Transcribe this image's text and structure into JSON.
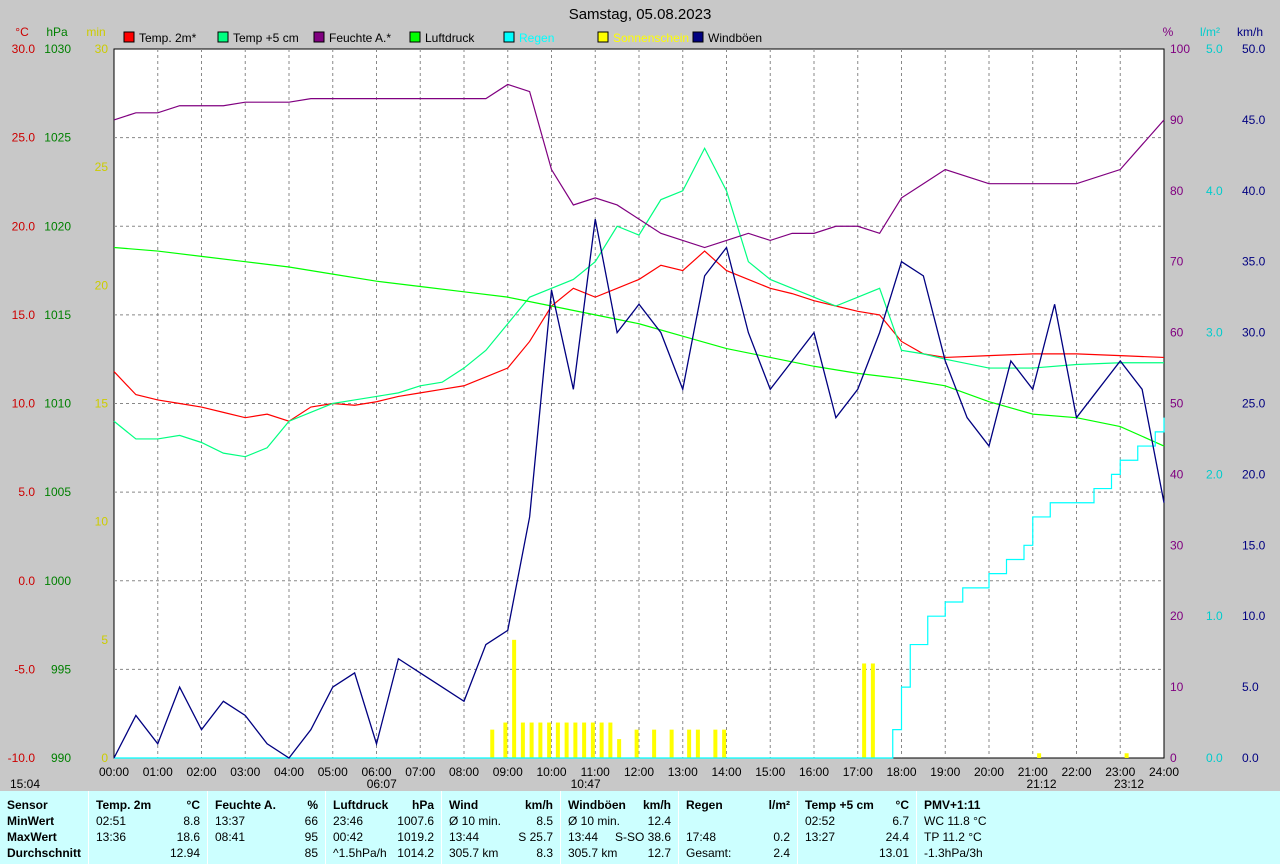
{
  "chart_data": {
    "type": "line",
    "title": "Samstag, 05.08.2023",
    "x_ticks": [
      "00:00",
      "01:00",
      "02:00",
      "03:00",
      "04:00",
      "05:00",
      "06:00",
      "07:00",
      "08:00",
      "09:00",
      "10:00",
      "11:00",
      "12:00",
      "13:00",
      "14:00",
      "15:00",
      "16:00",
      "17:00",
      "18:00",
      "19:00",
      "20:00",
      "21:00",
      "22:00",
      "23:00",
      "24:00"
    ],
    "axes": {
      "temp": {
        "unit": "°C",
        "range": [
          -10,
          30
        ],
        "ticks": [
          "30.0",
          "25.0",
          "20.0",
          "15.0",
          "10.0",
          "5.0",
          "0.0",
          "-5.0",
          "-10.0"
        ],
        "color": "#ff0000"
      },
      "pressure": {
        "unit": "hPa",
        "range": [
          990,
          1030
        ],
        "ticks": [
          "1030",
          "1025",
          "1020",
          "1015",
          "1010",
          "1005",
          "1000",
          "995",
          "990"
        ],
        "color": "#008000"
      },
      "sun": {
        "unit": "min",
        "range": [
          0,
          30
        ],
        "ticks": [
          "30",
          "25",
          "20",
          "15",
          "10",
          "5",
          "0"
        ],
        "color": "#ffff00"
      },
      "humidity": {
        "unit": "%",
        "range": [
          0,
          100
        ],
        "ticks": [
          "100",
          "90",
          "80",
          "70",
          "60",
          "50",
          "40",
          "30",
          "20",
          "10",
          "0"
        ],
        "color": "#800080"
      },
      "rain": {
        "unit": "l/m²",
        "range": [
          0,
          5
        ],
        "ticks": [
          "5.0",
          "4.0",
          "3.0",
          "2.0",
          "1.0",
          "0.0"
        ],
        "color": "#00ffff"
      },
      "wind": {
        "unit": "km/h",
        "range": [
          0,
          50
        ],
        "ticks": [
          "50.0",
          "45.0",
          "40.0",
          "35.0",
          "30.0",
          "25.0",
          "20.0",
          "15.0",
          "10.0",
          "5.0",
          "0.0"
        ],
        "color": "#000080"
      }
    },
    "legend": {
      "position": "top",
      "items": [
        {
          "name": "Temp. 2m*",
          "color": "#ff0000"
        },
        {
          "name": "Temp +5 cm",
          "color": "#00ff80"
        },
        {
          "name": "Feuchte A.*",
          "color": "#800080"
        },
        {
          "name": "Luftdruck",
          "color": "#00ff00"
        },
        {
          "name": "Regen",
          "color": "#00ffff"
        },
        {
          "name": "Sonnenschein",
          "color": "#ffff00"
        },
        {
          "name": "Windböen",
          "color": "#000080"
        }
      ]
    },
    "series": [
      {
        "key": "temp2m",
        "axis": "temp",
        "color": "#ff0000",
        "x": [
          0,
          0.5,
          1,
          1.5,
          2,
          2.5,
          3,
          3.5,
          4,
          4.5,
          5,
          5.5,
          6,
          6.5,
          7,
          7.5,
          8,
          8.5,
          9,
          9.5,
          10,
          10.5,
          11,
          11.5,
          12,
          12.5,
          13,
          13.5,
          14,
          14.5,
          15,
          15.5,
          16,
          16.5,
          17,
          17.5,
          18,
          18.5,
          19,
          20,
          21,
          22,
          23,
          24
        ],
        "y": [
          11.8,
          10.5,
          10.2,
          10.0,
          9.8,
          9.5,
          9.2,
          9.4,
          9.0,
          9.8,
          10.0,
          9.9,
          10.1,
          10.4,
          10.6,
          10.8,
          11.0,
          11.5,
          12.0,
          13.5,
          15.5,
          16.5,
          16.0,
          16.5,
          17.0,
          17.8,
          17.5,
          18.6,
          17.5,
          17.0,
          16.5,
          16.2,
          15.8,
          15.5,
          15.2,
          15.0,
          13.5,
          12.8,
          12.6,
          12.7,
          12.8,
          12.8,
          12.7,
          12.6
        ]
      },
      {
        "key": "temp5cm",
        "axis": "temp",
        "color": "#00ff80",
        "x": [
          0,
          0.5,
          1,
          1.5,
          2,
          2.5,
          3,
          3.5,
          4,
          4.5,
          5,
          5.5,
          6,
          6.5,
          7,
          7.5,
          8,
          8.5,
          9,
          9.5,
          10,
          10.5,
          11,
          11.5,
          12,
          12.5,
          13,
          13.5,
          14,
          14.5,
          15,
          15.5,
          16,
          16.5,
          17,
          17.5,
          18,
          18.5,
          19,
          20,
          21,
          22,
          23,
          24
        ],
        "y": [
          9.0,
          8.0,
          8.0,
          8.2,
          7.8,
          7.2,
          7.0,
          7.5,
          9.0,
          9.5,
          10.0,
          10.2,
          10.4,
          10.6,
          11.0,
          11.2,
          12.0,
          13.0,
          14.5,
          16.0,
          16.5,
          17.0,
          18.0,
          20.0,
          19.5,
          21.5,
          22.0,
          24.4,
          22.0,
          18.0,
          17.0,
          16.5,
          16.0,
          15.5,
          16.0,
          16.5,
          13.0,
          12.8,
          12.5,
          12.0,
          12.0,
          12.2,
          12.3,
          12.3
        ]
      },
      {
        "key": "humidity",
        "axis": "humidity",
        "color": "#800080",
        "x": [
          0,
          0.5,
          1,
          1.5,
          2,
          2.5,
          3,
          3.5,
          4,
          4.5,
          5,
          5.5,
          6,
          6.5,
          7,
          7.5,
          8,
          8.5,
          9,
          9.5,
          10,
          10.5,
          11,
          11.5,
          12,
          12.5,
          13,
          13.5,
          14,
          14.5,
          15,
          15.5,
          16,
          16.5,
          17,
          17.5,
          18,
          18.5,
          19,
          20,
          21,
          22,
          23,
          24
        ],
        "y": [
          90,
          91,
          91,
          92,
          92,
          92,
          92.5,
          92.5,
          92.5,
          93,
          93,
          93,
          93,
          93,
          93,
          93,
          93,
          93,
          95,
          94,
          83,
          78,
          79,
          78,
          76,
          74,
          73,
          72,
          73,
          74,
          73,
          74,
          74,
          75,
          75,
          74,
          79,
          81,
          83,
          81,
          81,
          81,
          83,
          90
        ]
      },
      {
        "key": "pressure",
        "axis": "pressure",
        "color": "#00ff00",
        "x": [
          0,
          1,
          2,
          3,
          4,
          5,
          6,
          7,
          8,
          9,
          10,
          11,
          12,
          13,
          14,
          15,
          16,
          17,
          18,
          19,
          20,
          21,
          22,
          23,
          24
        ],
        "y": [
          1018.8,
          1018.6,
          1018.3,
          1018.0,
          1017.7,
          1017.3,
          1016.9,
          1016.6,
          1016.3,
          1016.0,
          1015.5,
          1015.0,
          1014.5,
          1013.8,
          1013.1,
          1012.6,
          1012.1,
          1011.7,
          1011.4,
          1011.0,
          1010.1,
          1009.4,
          1009.2,
          1008.7,
          1007.6
        ]
      },
      {
        "key": "rain",
        "axis": "rain",
        "color": "#00ffff",
        "x": [
          0,
          17.6,
          17.8,
          18.0,
          18.2,
          18.6,
          19.0,
          19.4,
          20.0,
          20.4,
          20.8,
          21.0,
          21.4,
          21.8,
          22.0,
          22.4,
          22.8,
          23.0,
          23.4,
          23.8,
          24.0
        ],
        "y": [
          0,
          0,
          0.2,
          0.5,
          0.8,
          1.0,
          1.1,
          1.2,
          1.3,
          1.4,
          1.5,
          1.7,
          1.8,
          1.8,
          1.8,
          1.9,
          2.0,
          2.1,
          2.2,
          2.3,
          2.4
        ]
      },
      {
        "key": "gusts",
        "axis": "wind",
        "color": "#000080",
        "x": [
          0,
          0.5,
          1,
          1.5,
          2,
          2.5,
          3,
          3.5,
          4,
          4.5,
          5,
          5.5,
          6,
          6.5,
          7,
          7.5,
          8,
          8.5,
          9,
          9.5,
          10,
          10.5,
          11,
          11.5,
          12,
          12.5,
          13,
          13.5,
          14,
          14.5,
          15,
          15.5,
          16,
          16.5,
          17,
          17.5,
          18,
          18.5,
          19,
          19.5,
          20,
          20.5,
          21,
          21.5,
          22,
          22.5,
          23,
          23.5,
          24
        ],
        "y": [
          0,
          3,
          1,
          5,
          2,
          4,
          3,
          1,
          0,
          2,
          5,
          6,
          1,
          7,
          6,
          5,
          4,
          8,
          9,
          17,
          33,
          26,
          38,
          30,
          32,
          30,
          26,
          34,
          36,
          30,
          26,
          28,
          30,
          24,
          26,
          30,
          35,
          34,
          28,
          24,
          22,
          28,
          26,
          32,
          24,
          26,
          28,
          26,
          18
        ]
      },
      {
        "key": "sunshine",
        "axis": "sun",
        "color": "#ffff00",
        "type": "bar",
        "x": [
          8.6,
          8.9,
          9.1,
          9.3,
          9.5,
          9.7,
          9.9,
          10.1,
          10.3,
          10.5,
          10.7,
          10.9,
          11.1,
          11.3,
          11.5,
          11.7,
          11.9,
          12.1,
          12.3,
          12.5,
          12.7,
          12.9,
          13.1,
          13.3,
          13.5,
          13.7,
          13.9,
          17.1,
          17.3,
          21.1,
          23.1
        ],
        "y": [
          1.2,
          1.5,
          5.0,
          1.5,
          1.5,
          1.5,
          1.5,
          1.5,
          1.5,
          1.5,
          1.5,
          1.5,
          1.5,
          1.5,
          0.8,
          0,
          1.2,
          0,
          1.2,
          0,
          1.2,
          0,
          1.2,
          1.2,
          0,
          1.2,
          1.2,
          4.0,
          4.0,
          0.2,
          0.2
        ]
      }
    ],
    "annotations": [
      {
        "text": "15:04",
        "position": "bottom-left"
      },
      {
        "text": "06:07",
        "x": 6.12
      },
      {
        "text": "10:47",
        "x": 10.78
      },
      {
        "text": "21:12",
        "x": 21.2
      },
      {
        "text": "23:12",
        "x": 23.2
      }
    ],
    "grid": true
  },
  "footer": {
    "columns": [
      {
        "title": "Sensor",
        "rows": [
          "MinWert",
          "MaxWert",
          "Durchschnitt"
        ]
      },
      {
        "title": "Temp. 2m",
        "unit": "°C",
        "rows": [
          [
            "02:51",
            "8.8"
          ],
          [
            "13:36",
            "18.6"
          ],
          [
            "",
            "12.94"
          ]
        ]
      },
      {
        "title": "Feuchte A.",
        "unit": "%",
        "rows": [
          [
            "13:37",
            "66"
          ],
          [
            "08:41",
            "95"
          ],
          [
            "",
            "85"
          ]
        ]
      },
      {
        "title": "Luftdruck",
        "unit": "hPa",
        "rows": [
          [
            "23:46",
            "1007.6"
          ],
          [
            "00:42",
            "1019.2"
          ],
          [
            "^1.5hPa/h",
            "1014.2"
          ]
        ]
      },
      {
        "title": "Wind",
        "unit": "km/h",
        "rows": [
          [
            "Ø 10 min.",
            "8.5"
          ],
          [
            "13:44",
            "S 25.7"
          ],
          [
            "305.7 km",
            "8.3"
          ]
        ]
      },
      {
        "title": "Windböen",
        "unit": "km/h",
        "rows": [
          [
            "Ø 10 min.",
            "12.4"
          ],
          [
            "13:44",
            "S-SO 38.6"
          ],
          [
            "305.7 km",
            "12.7"
          ]
        ]
      },
      {
        "title": "Regen",
        "unit": "l/m²",
        "rows": [
          [
            "",
            ""
          ],
          [
            "17:48",
            "0.2"
          ],
          [
            "Gesamt:",
            "2.4"
          ]
        ]
      },
      {
        "title": "Temp +5 cm",
        "unit": "°C",
        "rows": [
          [
            "02:52",
            "6.7"
          ],
          [
            "13:27",
            "24.4"
          ],
          [
            "",
            "13.01"
          ]
        ]
      },
      {
        "title": "PMV+1:11",
        "unit": "",
        "rows": [
          [
            "WC 11.8 °C",
            ""
          ],
          [
            "TP 11.2 °C",
            ""
          ],
          [
            "-1.3hPa/3h",
            ""
          ]
        ]
      }
    ]
  }
}
